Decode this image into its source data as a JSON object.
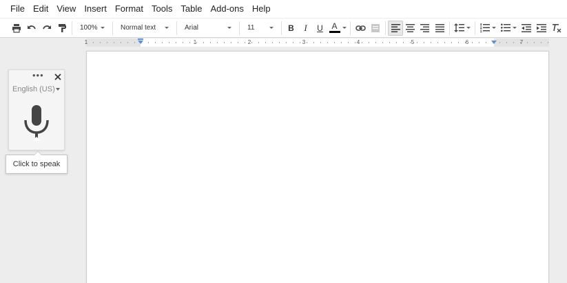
{
  "menu": {
    "items": [
      "File",
      "Edit",
      "View",
      "Insert",
      "Format",
      "Tools",
      "Table",
      "Add-ons",
      "Help"
    ]
  },
  "toolbar": {
    "zoom": "100%",
    "style": "Normal text",
    "font": "Arial",
    "size": "11",
    "bold_label": "B",
    "italic_label": "I",
    "underline_label": "U",
    "text_color_label": "A",
    "text_color": "#000000",
    "icons": [
      "print-icon",
      "undo-icon",
      "redo-icon",
      "paint-format-icon",
      "link-icon",
      "comment-icon",
      "align-left-icon",
      "align-center-icon",
      "align-right-icon",
      "justify-icon",
      "line-spacing-icon",
      "numbered-list-icon",
      "bulleted-list-icon",
      "decrease-indent-icon",
      "increase-indent-icon",
      "clear-formatting-icon"
    ],
    "active_alignment": "left"
  },
  "ruler": {
    "labels": [
      "1",
      "1",
      "2",
      "3",
      "4",
      "5",
      "6",
      "7"
    ]
  },
  "voice_typing": {
    "more_label": "•••",
    "language": "English (US)",
    "tooltip": "Click to speak"
  },
  "colors": {
    "accent": "#5b8fe0",
    "background": "#ededed",
    "page": "#ffffff"
  }
}
